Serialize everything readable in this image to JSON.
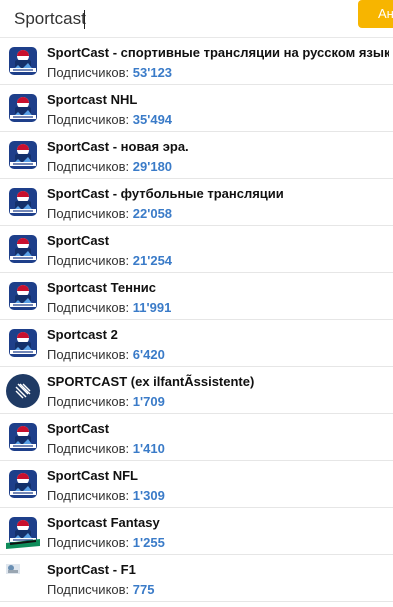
{
  "search": {
    "value": "Sportcast",
    "button_label": "Ан"
  },
  "subscribers_label": "Подписчиков:",
  "colors": {
    "button": "#f7b500",
    "count": "#3a7bc8"
  },
  "results": [
    {
      "name": "SportCast - спортивные трансляции на русском языке",
      "count": "53'123",
      "avatar": "sportcast-logo-icon"
    },
    {
      "name": "Sportcast NHL",
      "count": "35'494",
      "avatar": "sportcast-logo-icon"
    },
    {
      "name": "SportCast - новая эра.",
      "count": "29'180",
      "avatar": "sportcast-logo-icon"
    },
    {
      "name": "SportCast - футбольные трансляции",
      "count": "22'058",
      "avatar": "sportcast-logo-icon"
    },
    {
      "name": "SportCast",
      "count": "21'254",
      "avatar": "sportcast-logo-icon"
    },
    {
      "name": "Sportcast Теннис",
      "count": "11'991",
      "avatar": "sportcast-logo-icon"
    },
    {
      "name": "Sportcast 2",
      "count": "6'420",
      "avatar": "sportcast-logo-icon"
    },
    {
      "name": "SPORTCAST (ex ilfantÃssistente)",
      "count": "1'709",
      "avatar": "blue-circle-logo-icon"
    },
    {
      "name": "SportCast",
      "count": "1'410",
      "avatar": "sportcast-logo-icon"
    },
    {
      "name": "SportCast NFL",
      "count": "1'309",
      "avatar": "sportcast-logo-icon"
    },
    {
      "name": "Sportcast Fantasy",
      "count": "1'255",
      "avatar": "sportcast-fantasy-logo-icon"
    },
    {
      "name": "SportCast - F1",
      "count": "775",
      "avatar": "small-photo-icon"
    }
  ]
}
